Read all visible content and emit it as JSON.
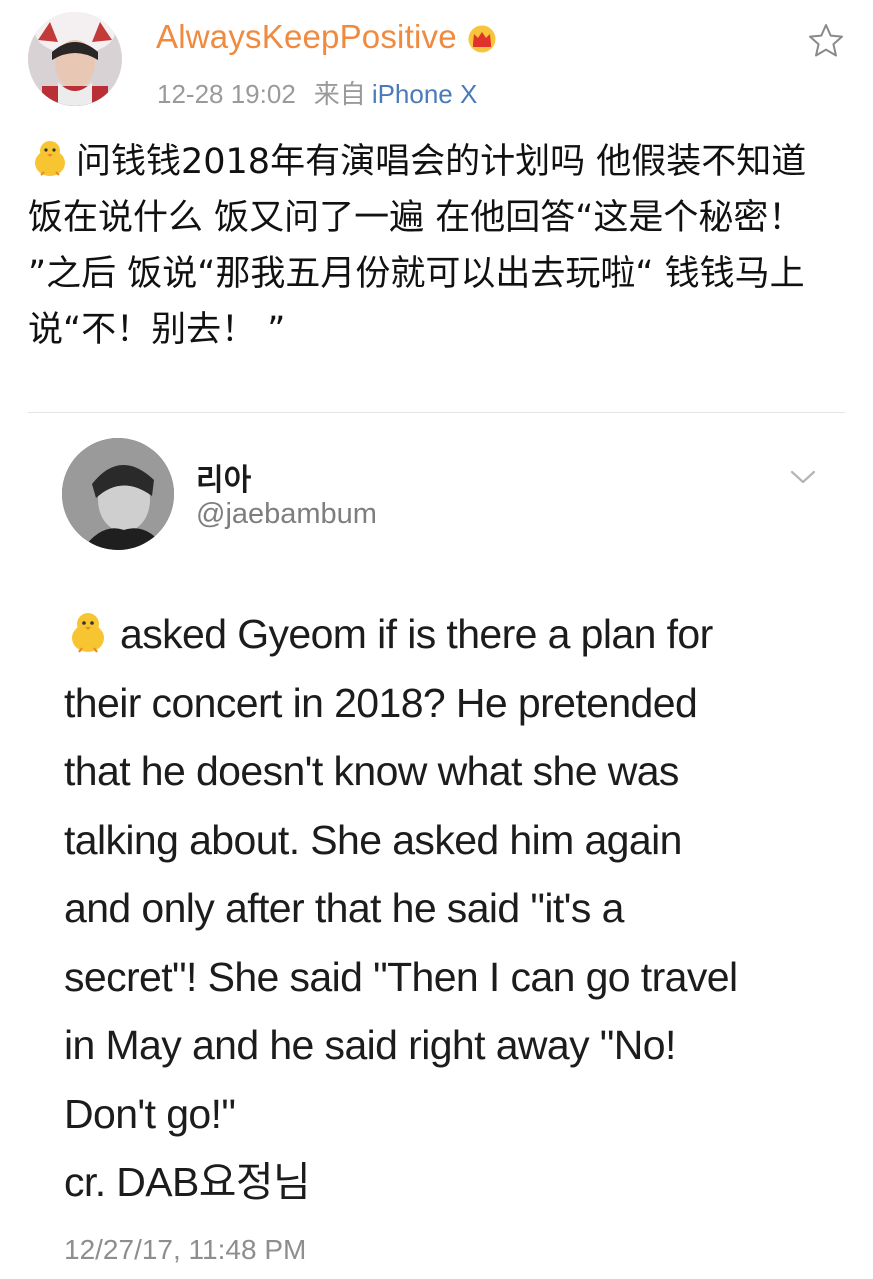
{
  "weibo": {
    "username": "AlwaysKeepPositive",
    "timestamp": "12-28 19:02",
    "source_prefix": "来自",
    "source": "iPhone X",
    "post_text": "问钱钱2018年有演唱会的计划吗 他假装不知道饭在说什么 饭又问了一遍 在他回答“这是个秘密！ ”之后 饭说“那我五月份就可以出去玩啦“ 钱钱马上说“不！别去！ ”",
    "icons": [
      "avatar",
      "crown-icon",
      "star-icon",
      "chick-icon"
    ]
  },
  "tweet": {
    "display_name": "리아",
    "handle": "@jaebambum",
    "body_lines": [
      "asked Gyeom if is there a plan for",
      "their concert in 2018? He pretended",
      "that he doesn't know what she was",
      "talking about. She asked him again",
      "and only after that he said \"it's a",
      "secret\"! She said \"Then I can go travel",
      "in May and he said right away \"No!",
      "Don't go!\""
    ],
    "credit": "cr. DAB요정님",
    "date": "12/27/17, 11:48 PM",
    "icons": [
      "avatar",
      "chick-icon",
      "chevron-down-icon"
    ]
  },
  "colors": {
    "username": "#f08a3e",
    "source_link": "#4a7bb8",
    "meta_gray": "#9a9a9a",
    "divider": "#e5e5e5"
  }
}
